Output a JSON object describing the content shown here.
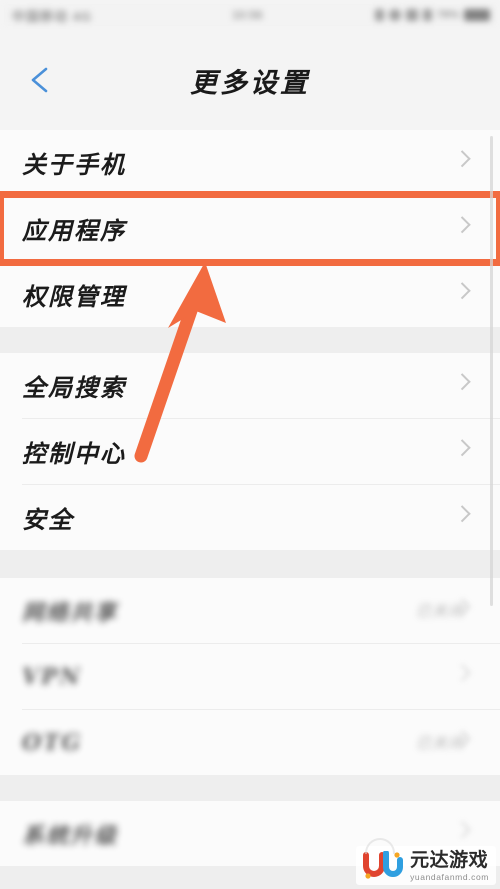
{
  "statusbar": {
    "carrier": "中国移动 4G",
    "time": "10:56",
    "battery_pct": "78%",
    "icons": [
      "signal-icon",
      "wifi-icon",
      "bluetooth-icon",
      "alarm-icon",
      "battery-icon"
    ]
  },
  "header": {
    "title": "更多设置",
    "back_icon": "chevron-left-icon"
  },
  "groups": [
    {
      "rows": [
        {
          "label": "关于手机",
          "value": "",
          "blurred": false,
          "highlighted": false
        },
        {
          "label": "应用程序",
          "value": "",
          "blurred": false,
          "highlighted": true
        },
        {
          "label": "权限管理",
          "value": "",
          "blurred": false,
          "highlighted": false
        }
      ]
    },
    {
      "rows": [
        {
          "label": "全局搜索",
          "value": "",
          "blurred": false,
          "highlighted": false
        },
        {
          "label": "控制中心",
          "value": "",
          "blurred": false,
          "highlighted": false
        },
        {
          "label": "安全",
          "value": "",
          "blurred": false,
          "highlighted": false
        }
      ]
    },
    {
      "rows": [
        {
          "label": "网络共享",
          "value": "已关闭",
          "blurred": true,
          "highlighted": false
        },
        {
          "label": "VPN",
          "value": "",
          "blurred": true,
          "highlighted": false
        },
        {
          "label": "OTG",
          "value": "已关闭",
          "blurred": true,
          "highlighted": false
        }
      ]
    },
    {
      "rows": [
        {
          "label": "系统升级",
          "value": "",
          "blurred": true,
          "highlighted": false
        }
      ]
    }
  ],
  "annotation": {
    "highlight_color": "#f26b40",
    "arrow_color": "#f26b40",
    "arrow_name": "pointer-arrow"
  },
  "watermark": {
    "cn": "元达游戏",
    "en": "yuandafanmd.com"
  },
  "colors": {
    "accent_orange": "#f26b40",
    "back_blue": "#4a90d9",
    "row_bg": "#fbfbfb",
    "page_bg": "#eeeeee"
  }
}
